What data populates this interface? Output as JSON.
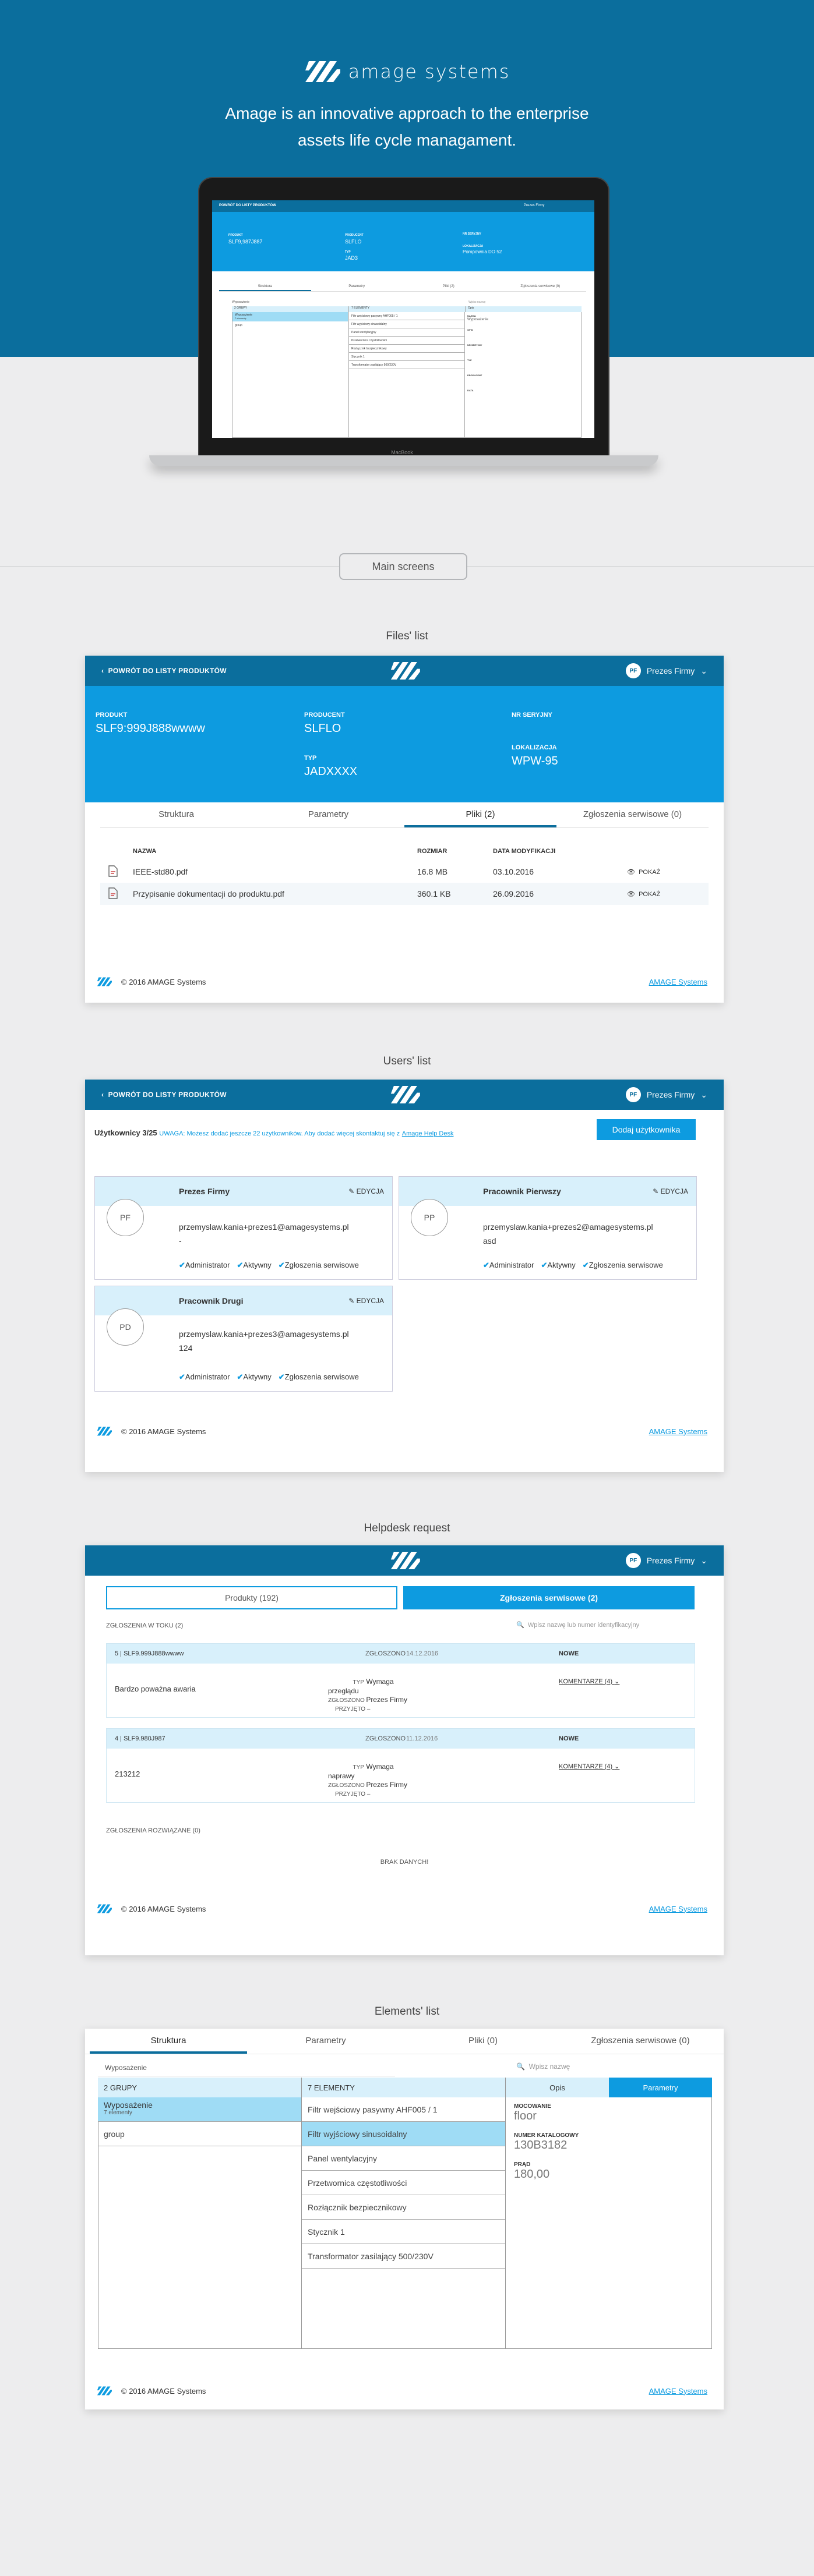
{
  "hero": {
    "brand": "amage systems",
    "tagline_line1": "Amage is an innovative approach to the enterprise",
    "tagline_line2": "assets life cycle managament."
  },
  "laptop": {
    "back": "POWRÓT DO LISTY PRODUKTÓW",
    "user": "Prezes Firmy",
    "product_label": "PRODUKT",
    "product": "SLF9,987J887",
    "producent_label": "PRODUCENT",
    "producent": "SLFLO",
    "typ_label": "TYP",
    "typ": "JAD3",
    "serial_label": "NR SERYJNY",
    "loc_label": "LOKALIZACJA",
    "loc": "Pompownia DO 52",
    "tabs": [
      "Struktura",
      "Parametry",
      "Pliki (2)",
      "Zgłoszenia serwisowe (0)"
    ],
    "search": "Wyposażenie",
    "search_placeholder": "Wpisz nazwę",
    "col1": "2 GRUPY",
    "col2": "7 ELEMENTY",
    "col3": "Opis",
    "g1": "Wyposażenie",
    "g1sub": "7 elementy",
    "g2": "group",
    "items": [
      "Filtr wejściowy pasywny AHF005 / 1",
      "Filtr wyjściowy sinusoidalny",
      "Panel wentylacyjny",
      "Przetwornica częstotliwości",
      "Rozłącznik bezpiecznikowy",
      "Stycznik 1",
      "Transformator zasilający 500/230V"
    ],
    "d1l": "NAZWA",
    "d1v": "Wyposażenie",
    "d2l": "OPIS",
    "d3l": "NR SERYJNY",
    "d4l": "TYP",
    "d5l": "PRODUCENT",
    "d6l": "DATA",
    "brand": "MacBook"
  },
  "main_screens": "Main screens",
  "files": {
    "section": "Files' list",
    "back": "POWRÓT DO LISTY PRODUKTÓW",
    "user": "Prezes Firmy",
    "user_initials": "PF",
    "product_label": "PRODUKT",
    "product": "SLF9:999J888wwww",
    "producent_label": "PRODUCENT",
    "producent": "SLFLO",
    "typ_label": "TYP",
    "typ": "JADXXXX",
    "serial_label": "NR SERYJNY",
    "loc_label": "LOKALIZACJA",
    "loc": "WPW-95",
    "tabs": [
      "Struktura",
      "Parametry",
      "Pliki (2)",
      "Zgłoszenia serwisowe (0)"
    ],
    "headers": [
      "NAZWA",
      "ROZMIAR",
      "DATA MODYFIKACJI"
    ],
    "rows": [
      {
        "name": "IEEE-std80.pdf",
        "size": "16.8 MB",
        "date": "03.10.2016",
        "action": "POKAŻ"
      },
      {
        "name": "Przypisanie dokumentacji do produktu.pdf",
        "size": "360.1 KB",
        "date": "26.09.2016",
        "action": "POKAŻ"
      }
    ],
    "footer": "© 2016 AMAGE Systems",
    "footer_link": "AMAGE Systems"
  },
  "users": {
    "section": "Users' list",
    "back": "POWRÓT DO LISTY PRODUKTÓW",
    "user": "Prezes Firmy",
    "user_initials": "PF",
    "count": "Użytkownicy 3/25",
    "notice": "UWAGA: Możesz dodać jeszcze 22 użytkowników. Aby dodać więcej skontaktuj się z",
    "notice_link": "Amage Help Desk",
    "add_button": "Dodaj użytkownika",
    "edit": "EDYCJA",
    "cards": [
      {
        "name": "Prezes Firmy",
        "initials": "PF",
        "mail": "przemyslaw.kania+prezes1@amagesystems.pl",
        "extra": "-"
      },
      {
        "name": "Pracownik Pierwszy",
        "initials": "PP",
        "mail": "przemyslaw.kania+prezes2@amagesystems.pl",
        "extra": "asd"
      },
      {
        "name": "Pracownik Drugi",
        "initials": "PD",
        "mail": "przemyslaw.kania+prezes3@amagesystems.pl",
        "extra": "124"
      }
    ],
    "perms": [
      "Administrator",
      "Aktywny",
      "Zgłoszenia serwisowe"
    ],
    "footer": "© 2016 AMAGE Systems",
    "footer_link": "AMAGE Systems"
  },
  "helpdesk": {
    "section": "Helpdesk request",
    "user": "Prezes Firmy",
    "user_initials": "PF",
    "tab_products": "Produkty (192)",
    "tab_requests": "Zgłoszenia serwisowe (2)",
    "open_label": "ZGŁOSZENIA W TOKU (2)",
    "search_placeholder": "Wpisz nazwę lub numer identyfikacyjny",
    "requests": [
      {
        "id": "5 | SLF9.999J888wwww",
        "reported_label": "ZGŁOSZONO",
        "reported": "14.12.2016",
        "status": "NOWE",
        "desc": "Bardzo poważna awaria",
        "typ_label": "TYP",
        "typ": "Wymaga przeglądu",
        "zgl_label": "ZGŁOSZONO",
        "zgl": "Prezes Firmy",
        "accepted": "PRZYJĘTO",
        "comments": "KOMENTARZE (4)"
      },
      {
        "id": "4 | SLF9.980J987",
        "reported_label": "ZGŁOSZONO",
        "reported": "11.12.2016",
        "status": "NOWE",
        "desc": "213212",
        "typ_label": "TYP",
        "typ": "Wymaga naprawy",
        "zgl_label": "ZGŁOSZONO",
        "zgl": "Prezes Firmy",
        "accepted": "PRZYJĘTO",
        "comments": "KOMENTARZE (4)"
      }
    ],
    "resolved_label": "ZGŁOSZENIA ROZWIĄZANE (0)",
    "empty": "BRAK DANYCH!",
    "footer": "© 2016 AMAGE Systems",
    "footer_link": "AMAGE Systems"
  },
  "elements": {
    "section": "Elements' list",
    "tabs": [
      "Struktura",
      "Parametry",
      "Pliki (0)",
      "Zgłoszenia serwisowe (0)"
    ],
    "search": "Wyposażenie",
    "search_placeholder": "Wpisz nazwę",
    "col1": "2 GRUPY",
    "col2": "7 ELEMENTY",
    "opis": "Opis",
    "parametry": "Parametry",
    "g1": "Wyposażenie",
    "g1sub": "7 elementy",
    "g2": "group",
    "items": [
      "Filtr wejściowy pasywny AHF005 / 1",
      "Filtr wyjściowy sinusoidalny",
      "Panel wentylacyjny",
      "Przetwornica częstotliwości",
      "Rozłącznik bezpiecznikowy",
      "Stycznik 1",
      "Transformator zasilający 500/230V"
    ],
    "p1l": "MOCOWANIE",
    "p1v": "floor",
    "p2l": "NUMER KATALOGOWY",
    "p2v": "130B3182",
    "p3l": "PRĄD",
    "p3v": "180,00",
    "footer": "© 2016 AMAGE Systems",
    "footer_link": "AMAGE Systems"
  },
  "colors": {
    "dark_blue": "#0b6e9d",
    "light_blue": "#0d9be0",
    "pale_blue": "#d8f0fb"
  }
}
